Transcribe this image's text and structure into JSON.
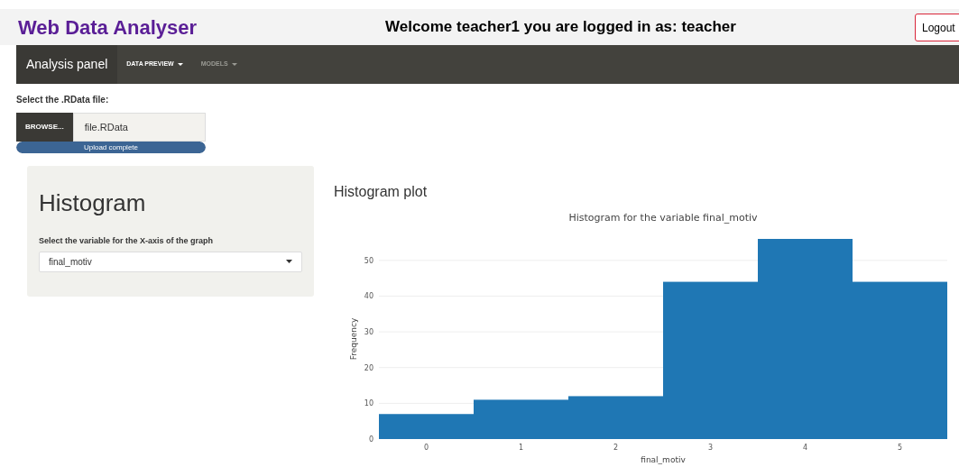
{
  "header": {
    "title": "Web Data Analyser",
    "welcome": "Welcome teacher1 you are logged in as: teacher",
    "logout": "Logout"
  },
  "navbar": {
    "brand": "Analysis panel",
    "items": [
      {
        "label": "DATA PREVIEW",
        "selected": true
      },
      {
        "label": "MODELS",
        "selected": false
      }
    ]
  },
  "file_input": {
    "label": "Select the .RData file:",
    "button": "BROWSE...",
    "value": "file.RData",
    "progress": {
      "level": 1,
      "text": "Upload complete"
    }
  },
  "sidebar": {
    "title": "Histogram",
    "select_label": "Select the variable for the X-axis of the graph",
    "select_value": "final_motiv"
  },
  "plot": {
    "heading": "Histogram plot",
    "chart_data": {
      "type": "bar",
      "title": "Histogram for the variable final_motiv",
      "xlabel": "final_motiv",
      "ylabel": "Frequency",
      "categories": [
        "0",
        "1",
        "2",
        "3",
        "4",
        "5"
      ],
      "series": [
        {
          "color": "#1f77b4",
          "values": [
            7,
            11,
            12,
            44,
            56,
            44
          ]
        }
      ],
      "grid": true,
      "ylim": [
        0,
        56
      ],
      "yticks": [
        0,
        10,
        20,
        30,
        40,
        50
      ]
    }
  }
}
